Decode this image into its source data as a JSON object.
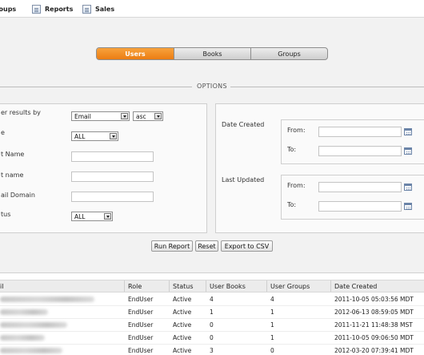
{
  "menu": {
    "items": [
      {
        "label": "Groups",
        "icon": "groups-icon"
      },
      {
        "label": "Reports",
        "icon": "reports-icon"
      },
      {
        "label": "Sales",
        "icon": "sales-icon"
      }
    ]
  },
  "tabs": [
    {
      "label": "Users",
      "active": true
    },
    {
      "label": "Books",
      "active": false
    },
    {
      "label": "Groups",
      "active": false
    }
  ],
  "options": {
    "title": "OPTIONS",
    "left": {
      "order_label": "er results by",
      "order_field": "Email",
      "order_dir": "asc",
      "role_label": "e",
      "role_value": "ALL",
      "first_name_label": "t Name",
      "last_name_label": "t name",
      "email_domain_label": "ail Domain",
      "status_label": "tus",
      "status_value": "ALL"
    },
    "right": {
      "date_created_label": "Date Created",
      "last_updated_label": "Last Updated",
      "from_label": "From:",
      "to_label": "To:"
    }
  },
  "buttons": {
    "run_report": "Run Report",
    "reset": "Reset",
    "export_csv": "Export to CSV"
  },
  "table": {
    "columns": [
      "il",
      "Role",
      "Status",
      "User Books",
      "User Groups",
      "Date Created"
    ],
    "rows": [
      {
        "role": "EndUser",
        "status": "Active",
        "books": "4",
        "groups": "4",
        "created": "2011-10-05 05:03:56 MDT"
      },
      {
        "role": "EndUser",
        "status": "Active",
        "books": "1",
        "groups": "1",
        "created": "2012-06-13 08:59:05 MDT"
      },
      {
        "role": "EndUser",
        "status": "Active",
        "books": "0",
        "groups": "1",
        "created": "2011-11-21 11:48:38 MST"
      },
      {
        "role": "EndUser",
        "status": "Active",
        "books": "0",
        "groups": "1",
        "created": "2011-10-05 09:06:50 MDT"
      },
      {
        "role": "EndUser",
        "status": "Active",
        "books": "3",
        "groups": "0",
        "created": "2012-03-20 07:39:41 MDT"
      }
    ]
  },
  "colors": {
    "accent": "#f08a1e",
    "background": "#f2f2f2"
  }
}
